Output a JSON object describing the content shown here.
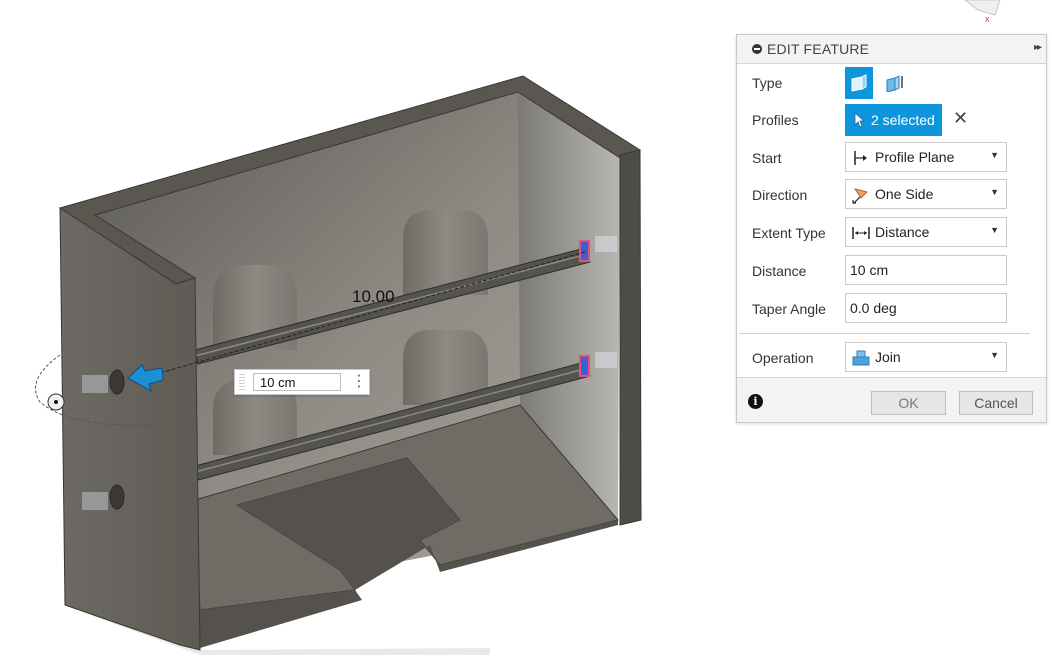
{
  "viewport": {
    "dimension_label": "10.00",
    "distance_input_value": "10 cm",
    "more_menu_icon": "vertical-ellipsis-icon"
  },
  "panel": {
    "title": "EDIT FEATURE",
    "rows": {
      "type": {
        "label": "Type"
      },
      "profiles": {
        "label": "Profiles",
        "value": "2 selected"
      },
      "start": {
        "label": "Start",
        "value": "Profile Plane"
      },
      "direction": {
        "label": "Direction",
        "value": "One Side"
      },
      "extent_type": {
        "label": "Extent Type",
        "value": "Distance"
      },
      "distance": {
        "label": "Distance",
        "value": "10 cm"
      },
      "taper_angle": {
        "label": "Taper Angle",
        "value": "0.0 deg"
      },
      "operation": {
        "label": "Operation",
        "value": "Join"
      }
    },
    "buttons": {
      "ok": "OK",
      "cancel": "Cancel"
    }
  },
  "colors": {
    "accent": "#0e96dc",
    "model_front": "#686560",
    "model_inner": "#8a8780"
  }
}
